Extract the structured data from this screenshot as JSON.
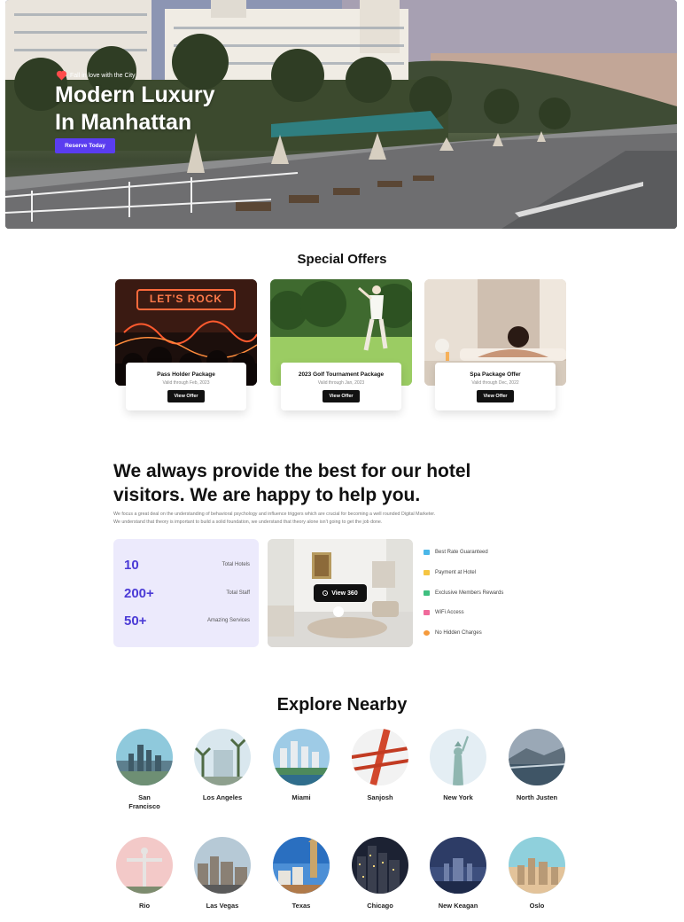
{
  "hero": {
    "kicker": "Fall in love with the City",
    "title_line1": "Modern Luxury",
    "title_line2": "In Manhattan",
    "cta": "Reserve Today"
  },
  "offers": {
    "heading": "Special Offers",
    "items": [
      {
        "name": "Pass Holder Package",
        "valid": "Valid through Feb, 2023",
        "button": "View Offer"
      },
      {
        "name": "2023 Golf Tournament Package",
        "valid": "Valid through Jan, 2023",
        "button": "View Offer"
      },
      {
        "name": "Spa Package Offer",
        "valid": "Valid through Dec, 2022",
        "button": "View Offer"
      }
    ],
    "sign_text": "LET'S ROCK"
  },
  "about": {
    "title_line1": "We always provide the best for our hotel",
    "title_line2": "visitors. We are happy to help you.",
    "desc_line1": "We focus a great deal on the understanding of behavioral psychology and influence triggers which are crucial for becoming a well rounded Digital Marketer.",
    "desc_line2": "We understand that theory is important to build a solid foundation, we understand that theory alone isn't going to get the job done.",
    "stats": [
      {
        "value": "10",
        "label": "Total Hotels"
      },
      {
        "value": "200+",
        "label": "Total Staff"
      },
      {
        "value": "50+",
        "label": "Amazing Services"
      }
    ],
    "view_button": "View 360",
    "features": [
      {
        "label": "Best Rate Guaranteed",
        "icon": "tag-icon",
        "color": "#4bb7e8"
      },
      {
        "label": "Payment at Hotel",
        "icon": "card-icon",
        "color": "#f5c542"
      },
      {
        "label": "Exclusive Members Rewards",
        "icon": "gift-icon",
        "color": "#3fbf7f"
      },
      {
        "label": "WiFi Access",
        "icon": "wifi-icon",
        "color": "#f06a9b"
      },
      {
        "label": "No Hidden Charges",
        "icon": "coin-icon",
        "color": "#f59a3c"
      }
    ]
  },
  "nearby": {
    "heading": "Explore Nearby",
    "cities": [
      {
        "line1": "San",
        "line2": "Francisco"
      },
      {
        "line1": "Los Angeles",
        "line2": ""
      },
      {
        "line1": "Miami",
        "line2": ""
      },
      {
        "line1": "Sanjosh",
        "line2": ""
      },
      {
        "line1": "New York",
        "line2": ""
      },
      {
        "line1": "North Justen",
        "line2": ""
      },
      {
        "line1": "Rio",
        "line2": ""
      },
      {
        "line1": "Las Vegas",
        "line2": ""
      },
      {
        "line1": "Texas",
        "line2": ""
      },
      {
        "line1": "Chicago",
        "line2": ""
      },
      {
        "line1": "New Keagan",
        "line2": ""
      },
      {
        "line1": "Oslo",
        "line2": ""
      }
    ]
  },
  "colors": {
    "accent": "#5a3df0",
    "stat_number": "#4b3bd6",
    "stats_bg": "#eceafc",
    "button_dark": "#111111"
  }
}
